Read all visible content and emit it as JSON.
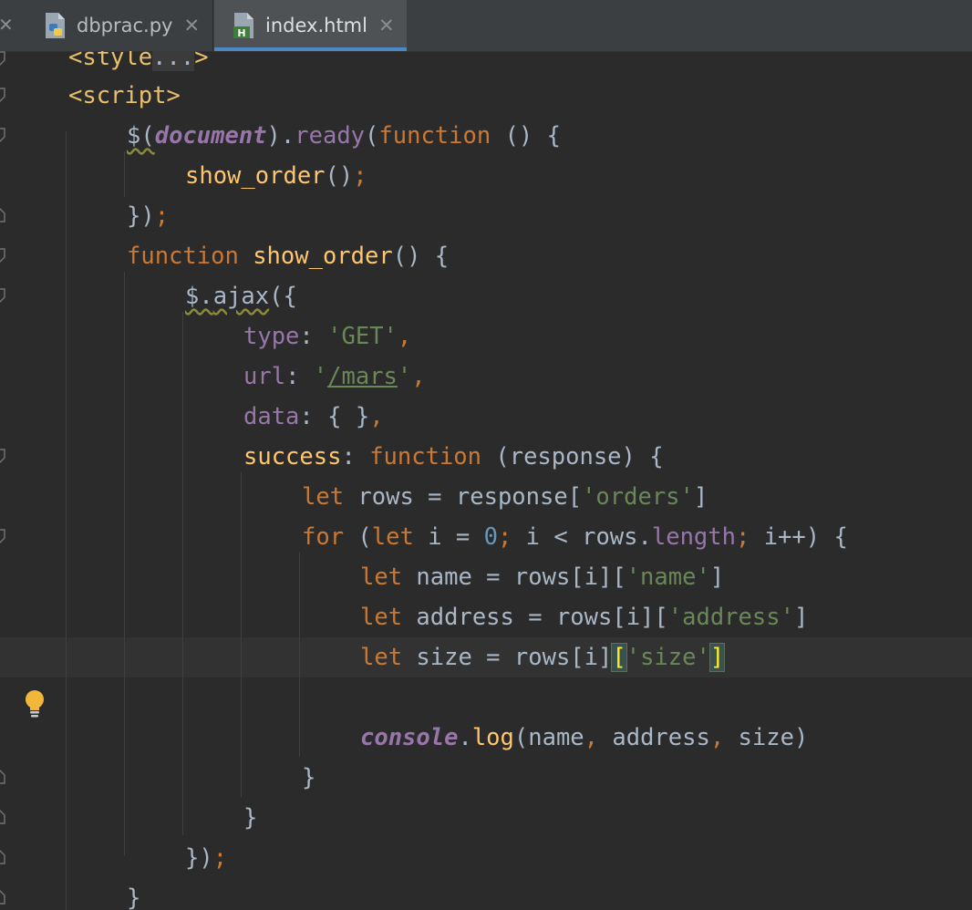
{
  "tabs": [
    {
      "name": "dbprac.py",
      "icon": "python-file-icon"
    },
    {
      "name": "index.html",
      "icon": "html-file-icon",
      "active": true
    }
  ],
  "close_glyph": "✕",
  "code": {
    "l1": {
      "a": "<style",
      "b": "...",
      "c": ">"
    },
    "l2": {
      "a": "<script>"
    },
    "l3": {
      "a": "$(",
      "b": "document",
      "c": ").",
      "d": "ready",
      "e": "(",
      "f": "function",
      "g": " () {"
    },
    "l4": {
      "a": "show_order",
      "b": "()",
      "c": ";"
    },
    "l5": {
      "a": "})",
      "b": ";"
    },
    "l6": {
      "a": "function",
      "b": " ",
      "c": "show_order",
      "d": "() {"
    },
    "l7": {
      "a": "$.",
      "b": "ajax",
      "c": "({"
    },
    "l8": {
      "a": "type",
      "b": ": ",
      "c": "'GET'",
      "d": ","
    },
    "l9": {
      "a": "url",
      "b": ": ",
      "c": "'",
      "d": "/mars",
      "e": "'",
      "f": ","
    },
    "l10": {
      "a": "data",
      "b": ": { }",
      "c": ","
    },
    "l11": {
      "a": "success",
      "b": ": ",
      "c": "function",
      "d": " (response) {"
    },
    "l12": {
      "a": "let",
      "b": " rows = response[",
      "c": "'orders'",
      "d": "]"
    },
    "l13": {
      "a": "for",
      "b": " (",
      "c": "let",
      "d": " i = ",
      "e": "0",
      "f": ";",
      "g": " i < rows.",
      "h": "length",
      "i": ";",
      "j": " i++) {"
    },
    "l14": {
      "a": "let",
      "b": " name = rows[i][",
      "c": "'name'",
      "d": "]"
    },
    "l15": {
      "a": "let",
      "b": " address = rows[i][",
      "c": "'address'",
      "d": "]"
    },
    "l16": {
      "a": "let",
      "b": " size = rows[i]",
      "c": "[",
      "d": "'size'",
      "e": "]"
    },
    "l17": {
      "a": "console",
      "b": ".",
      "c": "log",
      "d": "(name",
      "e": ",",
      "f": " address",
      "g": ",",
      "h": " size)"
    },
    "l18": {
      "a": "}"
    },
    "l19": {
      "a": "}"
    },
    "l20": {
      "a": "})",
      "b": ";"
    },
    "l21": {
      "a": "}"
    }
  }
}
